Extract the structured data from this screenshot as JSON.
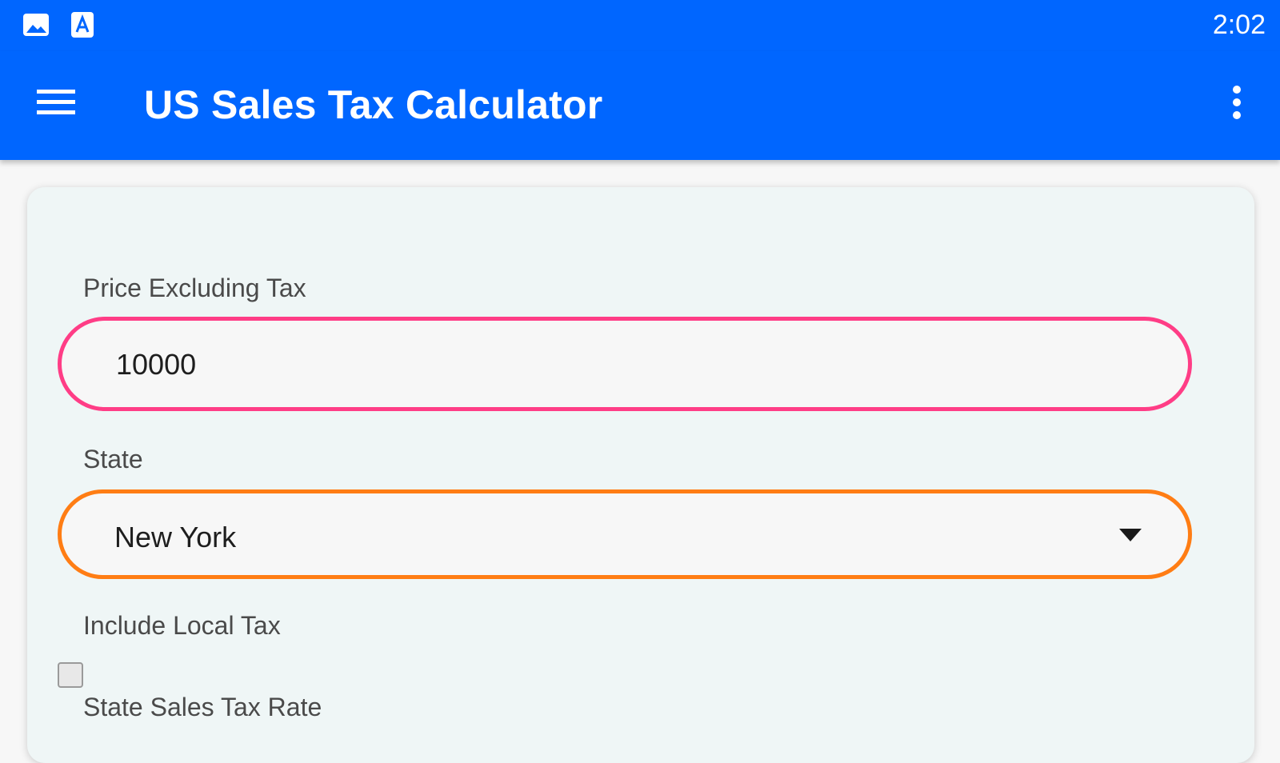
{
  "status_bar": {
    "icons": [
      "image-icon",
      "text-a-icon"
    ],
    "time": "2:02"
  },
  "app_bar": {
    "title": "US Sales Tax Calculator",
    "menu_icon": "hamburger-menu-icon",
    "overflow_icon": "more-vertical-icon"
  },
  "form": {
    "price": {
      "label": "Price Excluding Tax",
      "value": "10000"
    },
    "state": {
      "label": "State",
      "selected": "New York"
    },
    "local_tax": {
      "label": "Include Local Tax",
      "checked": false
    },
    "state_rate": {
      "label": "State Sales Tax Rate"
    }
  },
  "colors": {
    "primary": "#0066ff",
    "price_border": "#ff3d86",
    "state_border": "#ff7d14",
    "card_bg": "#eff6f6"
  }
}
